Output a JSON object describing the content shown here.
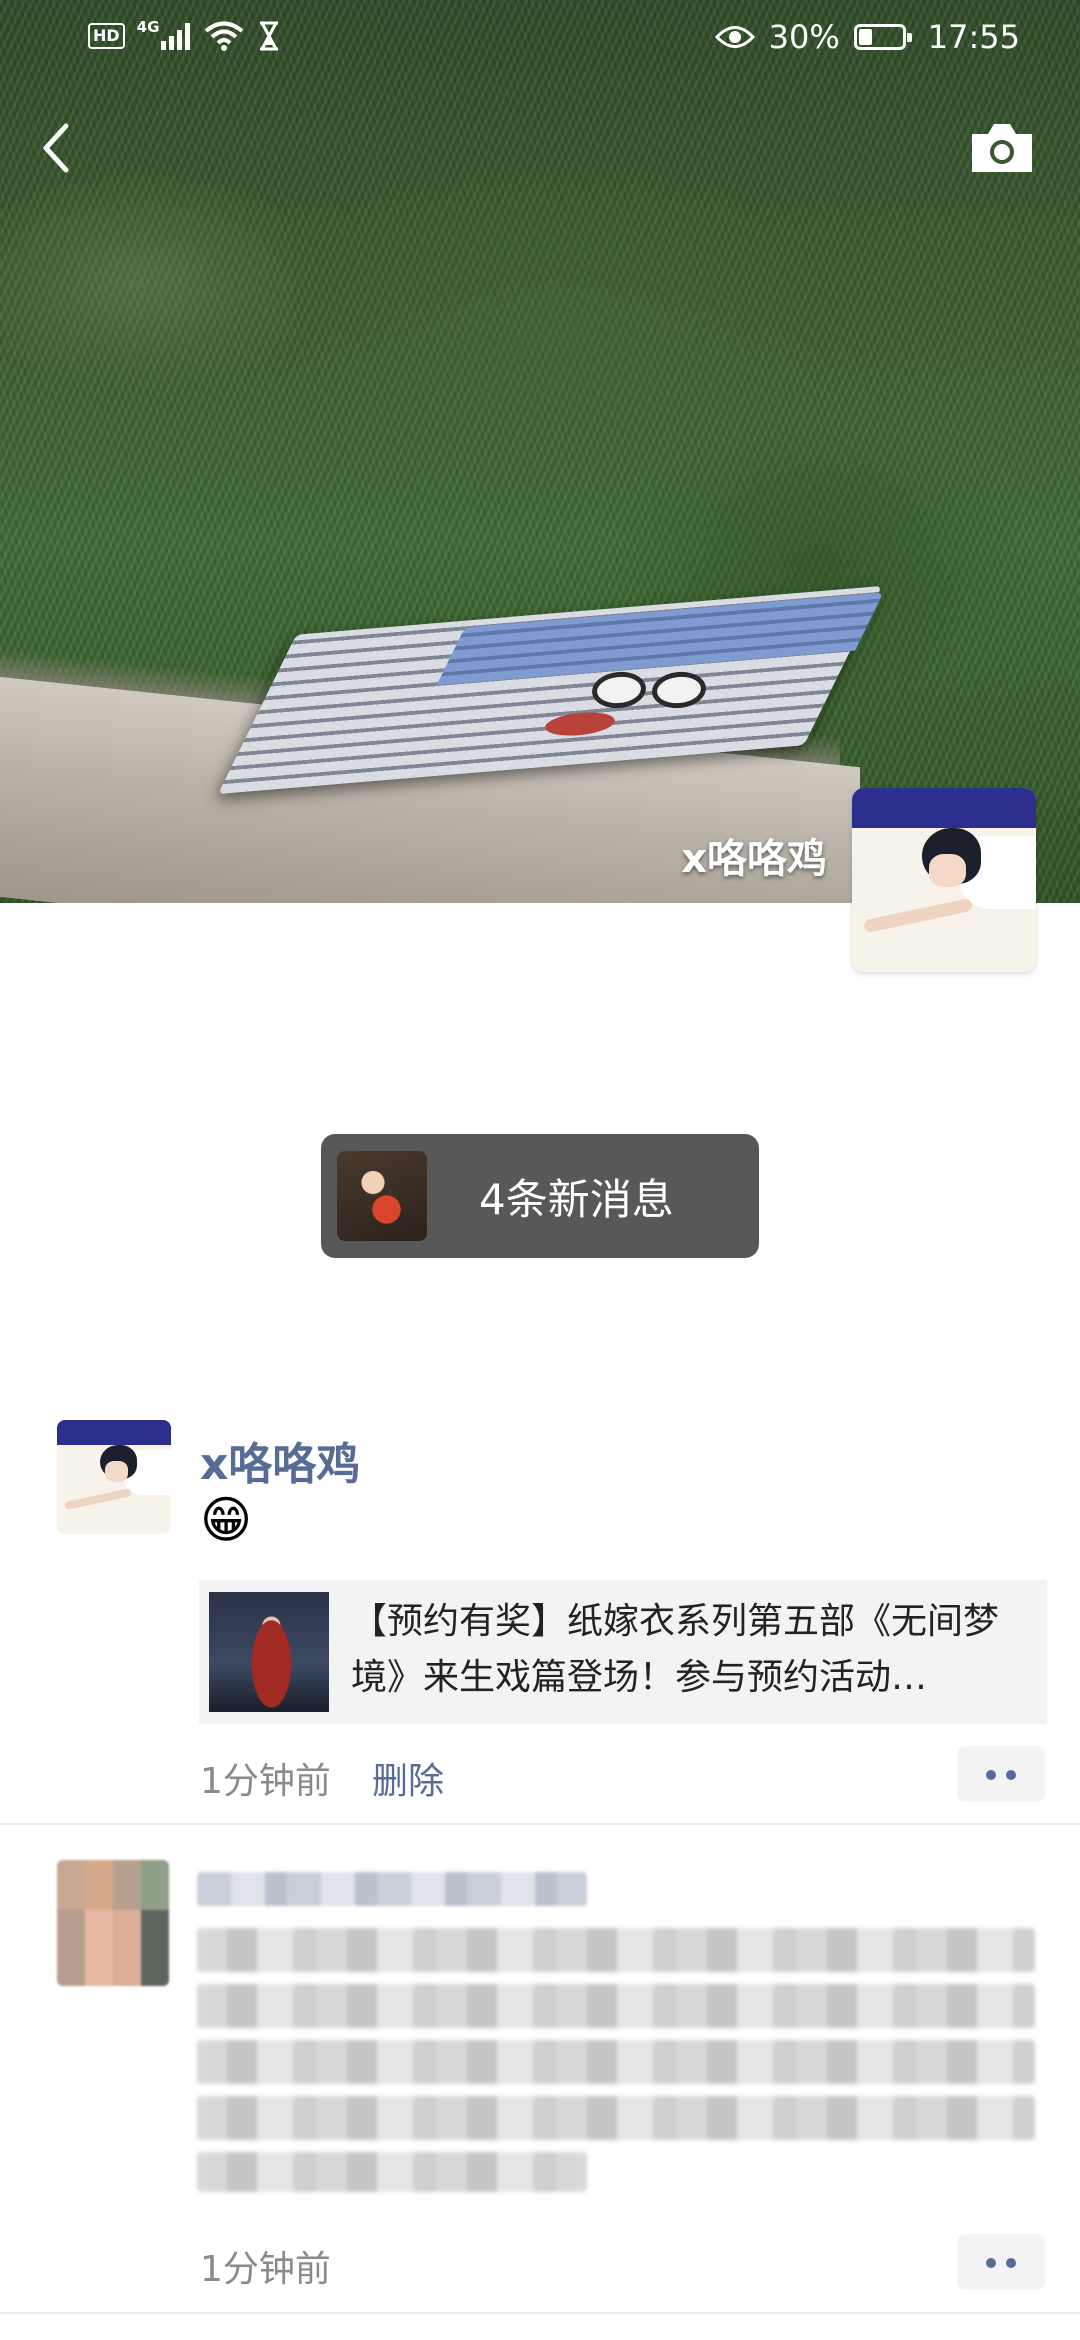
{
  "status_bar": {
    "left_badges": [
      "HD",
      "4G"
    ],
    "battery_percent": "30%",
    "battery_level": 0.3,
    "time": "17:55",
    "icons": [
      "hd-icon",
      "signal-icon",
      "wifi-icon",
      "hourglass-icon",
      "eye-icon",
      "battery-icon"
    ]
  },
  "header": {
    "back_icon": "chevron-left-icon",
    "camera_icon": "camera-icon"
  },
  "profile": {
    "name": "x咯咯鸡"
  },
  "new_messages": {
    "label": "4条新消息"
  },
  "posts": [
    {
      "author": "x咯咯鸡",
      "emoji": "😁",
      "link_text": "【预约有奖】纸嫁衣系列第五部《无间梦境》来生戏篇登场！参与预约活动…",
      "time": "1分钟前",
      "delete_label": "删除"
    },
    {
      "time": "1分钟前"
    }
  ],
  "colors": {
    "link_blue": "#566b95",
    "pill_bg": "#585858",
    "card_bg": "#f3f3f3"
  }
}
